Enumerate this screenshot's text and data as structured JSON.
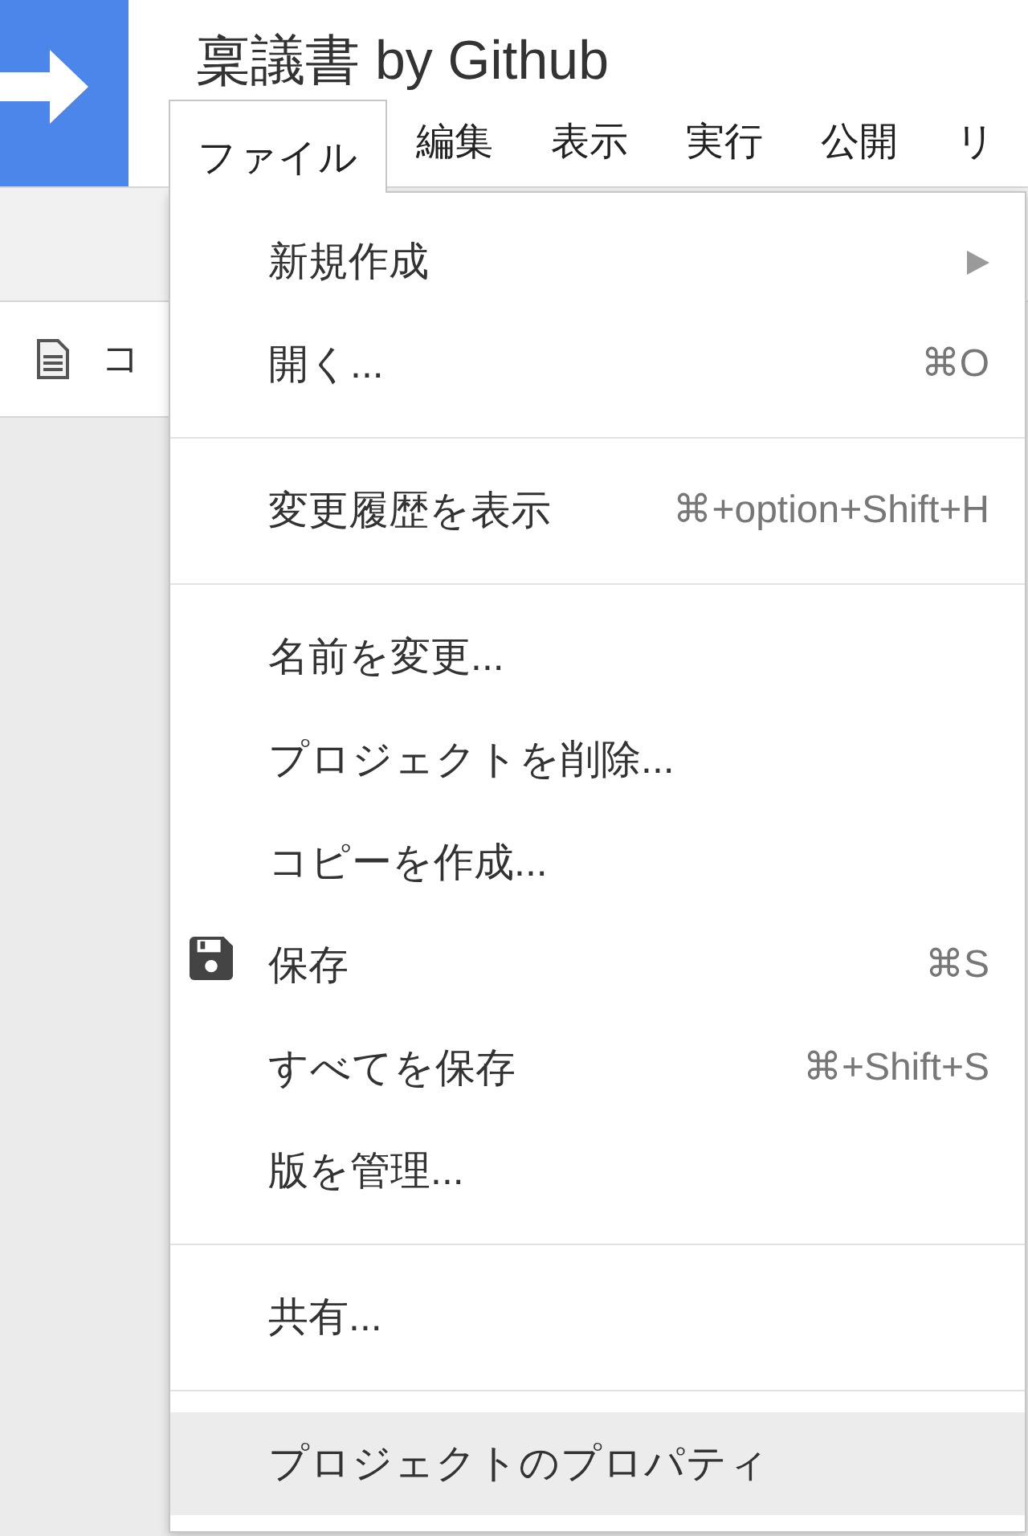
{
  "header": {
    "title": "稟議書 by Github"
  },
  "menu_bar": [
    {
      "label": "ファイル",
      "selected": true
    },
    {
      "label": "編集",
      "selected": false
    },
    {
      "label": "表示",
      "selected": false
    },
    {
      "label": "実行",
      "selected": false
    },
    {
      "label": "公開",
      "selected": false
    },
    {
      "label": "リ",
      "selected": false
    }
  ],
  "file_list": [
    {
      "name": "コ"
    }
  ],
  "file_menu": {
    "items": [
      {
        "kind": "item",
        "label": "新規作成",
        "submenu": true,
        "highlighted": false
      },
      {
        "kind": "item",
        "label": "開く...",
        "shortcut": "⌘O",
        "submenu": false,
        "highlighted": false
      },
      {
        "kind": "separator"
      },
      {
        "kind": "item",
        "label": "変更履歴を表示",
        "shortcut": "⌘+option+Shift+H",
        "submenu": false,
        "highlighted": false
      },
      {
        "kind": "separator"
      },
      {
        "kind": "item",
        "label": "名前を変更...",
        "submenu": false,
        "highlighted": false
      },
      {
        "kind": "item",
        "label": "プロジェクトを削除...",
        "submenu": false,
        "highlighted": false
      },
      {
        "kind": "item",
        "label": "コピーを作成...",
        "submenu": false,
        "highlighted": false
      },
      {
        "kind": "saveitem",
        "label": "保存",
        "shortcut": "⌘S",
        "submenu": false,
        "highlighted": false
      },
      {
        "kind": "item",
        "label": "すべてを保存",
        "shortcut": "⌘+Shift+S",
        "submenu": false,
        "highlighted": false
      },
      {
        "kind": "item",
        "label": "版を管理...",
        "submenu": false,
        "highlighted": false
      },
      {
        "kind": "separator"
      },
      {
        "kind": "item",
        "label": "共有...",
        "submenu": false,
        "highlighted": false
      },
      {
        "kind": "separator"
      },
      {
        "kind": "item",
        "label": "プロジェクトのプロパティ",
        "submenu": false,
        "highlighted": true
      }
    ]
  }
}
